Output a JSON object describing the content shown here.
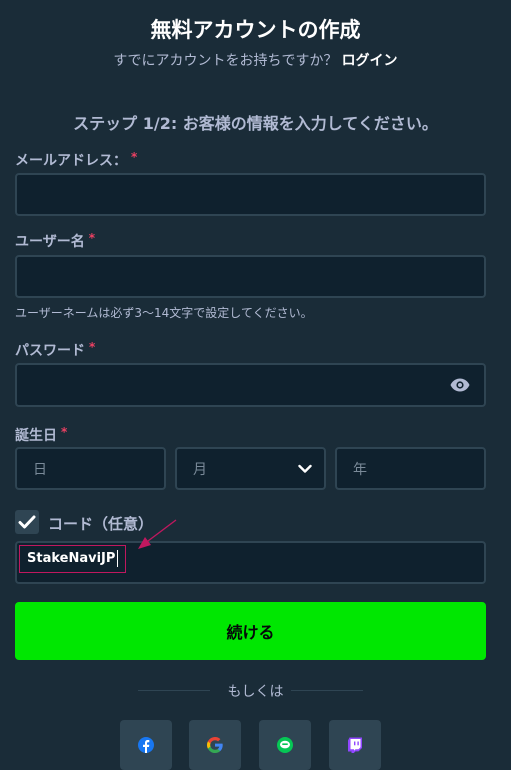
{
  "header": {
    "title": "無料アカウントの作成",
    "subtitle": "すでにアカウントをお持ちですか？",
    "login_link": "ログイン"
  },
  "step": "ステップ 1/2: お客様の情報を入力してください。",
  "form": {
    "email_label": "メールアドレス：",
    "email_value": "",
    "username_label": "ユーザー名",
    "username_value": "",
    "username_hint": "ユーザーネームは必ず3〜14文字で設定してください。",
    "password_label": "パスワード",
    "password_value": "",
    "required_mark": "*",
    "dob_label": "誕生日",
    "dob_day_placeholder": "日",
    "dob_month_placeholder": "月",
    "dob_year_placeholder": "年",
    "code_checked": true,
    "code_label": "コード（任意）",
    "code_value": "StakeNaviJP"
  },
  "continue_label": "続ける",
  "or_text": "もしくは",
  "social": [
    {
      "name": "facebook-icon",
      "color": "#1877f2"
    },
    {
      "name": "google-icon",
      "color": "#4285f4"
    },
    {
      "name": "line-icon",
      "color": "#06c755"
    },
    {
      "name": "twitch-icon",
      "color": "#9146ff"
    }
  ],
  "colors": {
    "background": "#1a2c38",
    "input_bg": "#0f212e",
    "input_border": "#2f4553",
    "accent_green": "#00e701",
    "required_red": "#ed4163",
    "annotation": "#c0185f"
  }
}
